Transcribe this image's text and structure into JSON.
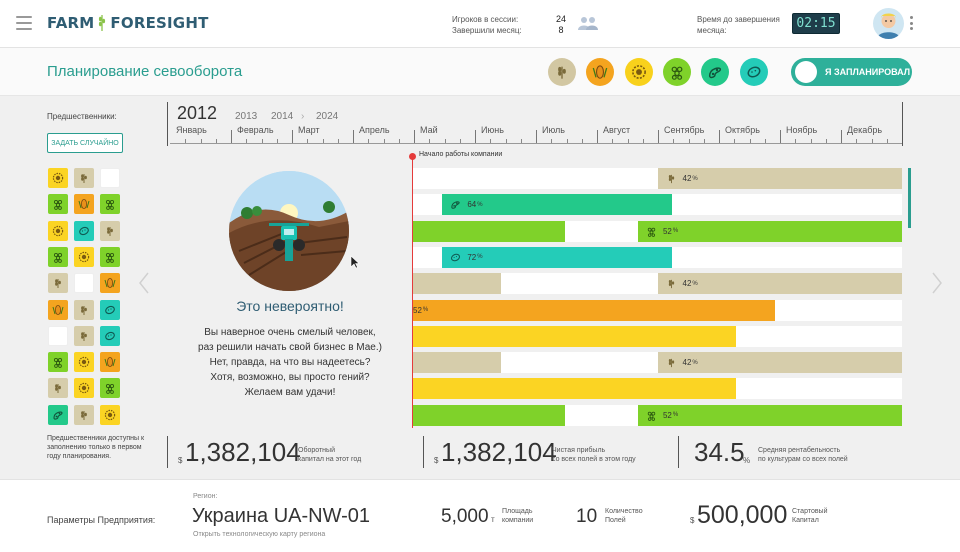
{
  "header": {
    "logo_left": "FARM",
    "logo_right": "FORESIGHT",
    "players_label": "Игроков в сессии:",
    "players_value": "24",
    "finished_label": "Завершили месяц:",
    "finished_value": "8",
    "time_label_1": "Время до завершения",
    "time_label_2": "месяца:",
    "timer": "02:15"
  },
  "planning": {
    "title": "Планирование севооборота",
    "crops": [
      {
        "icon": "wheat-icon",
        "color": "#d2c7a2"
      },
      {
        "icon": "corn-icon",
        "color": "#f4a41f"
      },
      {
        "icon": "sunflower-icon",
        "color": "#f8d11c"
      },
      {
        "icon": "grapes-icon",
        "color": "#7fd22a"
      },
      {
        "icon": "soybean-icon",
        "color": "#23c98a"
      },
      {
        "icon": "potato-icon",
        "color": "#24ccb8"
      }
    ],
    "toggle_label": "Я ЗАПЛАНИРОВАЛ"
  },
  "predecessors": {
    "label": "Предшественники:",
    "random_button": "ЗАДАТЬ СЛУЧАЙНО",
    "note": "Предшественники доступны к заполнению только в первом году планирования.",
    "rows": [
      [
        "sunflower",
        "wheat",
        "empty"
      ],
      [
        "grapes",
        "corn",
        "grapes"
      ],
      [
        "sunflower",
        "potato",
        "wheat"
      ],
      [
        "grapes",
        "sunflower",
        "grapes"
      ],
      [
        "wheat",
        "empty",
        "corn"
      ],
      [
        "corn",
        "wheat",
        "potato"
      ],
      [
        "empty",
        "wheat",
        "potato"
      ],
      [
        "grapes",
        "sunflower",
        "corn"
      ],
      [
        "wheat",
        "sunflower",
        "grapes"
      ],
      [
        "soybean",
        "wheat",
        "sunflower"
      ]
    ]
  },
  "timeline": {
    "year_current": "2012",
    "years": [
      "2013",
      "2014",
      "2024"
    ],
    "arrow": "›",
    "months": [
      "Январь",
      "Февраль",
      "Март",
      "Апрель",
      "Май",
      "Июнь",
      "Июль",
      "Август",
      "Сентябрь",
      "Октябрь",
      "Ноябрь",
      "Декабрь"
    ],
    "start_label": "Начало работы компании"
  },
  "fields": [
    [
      {
        "from": 0.5,
        "to": 1.0,
        "color": "#d6cdab",
        "icon": "wheat",
        "pct": "42"
      }
    ],
    [
      {
        "from": 0.06,
        "to": 0.53,
        "color": "#23c98a",
        "icon": "soybean",
        "pct": "64"
      }
    ],
    [
      {
        "from": 0,
        "to": 0.31,
        "color": "#7fd22a"
      },
      {
        "from": 0.46,
        "to": 1.0,
        "color": "#7fd22a",
        "icon": "grapes",
        "pct": "52"
      }
    ],
    [
      {
        "from": 0.06,
        "to": 0.53,
        "color": "#24ccb8",
        "icon": "potato",
        "pct": "72"
      }
    ],
    [
      {
        "from": 0,
        "to": 0.18,
        "color": "#d6cdab"
      },
      {
        "from": 0.5,
        "to": 1.0,
        "color": "#d6cdab",
        "icon": "wheat",
        "pct": "42"
      }
    ],
    [
      {
        "from": 0,
        "to": 0.74,
        "color": "#f4a41f",
        "pct": "52",
        "noicon": true
      }
    ],
    [
      {
        "from": 0,
        "to": 0.66,
        "color": "#fbd423"
      }
    ],
    [
      {
        "from": 0,
        "to": 0.18,
        "color": "#d6cdab"
      },
      {
        "from": 0.5,
        "to": 1.0,
        "color": "#d6cdab",
        "icon": "wheat",
        "pct": "42"
      }
    ],
    [
      {
        "from": 0,
        "to": 0.66,
        "color": "#fbd423"
      }
    ],
    [
      {
        "from": 0,
        "to": 0.31,
        "color": "#7fd22a"
      },
      {
        "from": 0.46,
        "to": 1.0,
        "color": "#7fd22a",
        "icon": "grapes",
        "pct": "52"
      }
    ]
  ],
  "popup": {
    "heading": "Это невероятно!",
    "line1": "Вы наверное очень смелый человек,",
    "line2": "раз решили начать свой бизнес в Мае.)",
    "line3": "Нет, правда, на что вы надеетесь?",
    "line4": "Хотя, возможно, вы просто гений?",
    "line5": "Желаем вам удачи!"
  },
  "stats": {
    "currency": "$",
    "working_capital": "1,382,104",
    "working_capital_label_1": "Оборотный",
    "working_capital_label_2": "капитал на этот год",
    "net_profit": "1,382,104",
    "net_profit_label_1": "Чистая прибыль",
    "net_profit_label_2": "со всех полей в этом году",
    "profitability": "34.5",
    "profitability_unit": "%",
    "profitability_label_1": "Средняя рентабельность",
    "profitability_label_2": "по культурам со всех полей",
    "pct_unit": "%"
  },
  "company": {
    "params_label": "Параметры Предприятия:",
    "region_label": "Регион:",
    "region_value": "Украина UA-NW-01",
    "region_link": "Открыть технологическую карту региона",
    "area_value": "5,000",
    "area_unit": "т",
    "area_label_1": "Площадь",
    "area_label_2": "компании",
    "fields_value": "10",
    "fields_label_1": "Количество",
    "fields_label_2": "Полей",
    "capital_currency": "$",
    "capital_value": "500,000",
    "capital_label_1": "Стартовый",
    "capital_label_2": "Капитал"
  }
}
